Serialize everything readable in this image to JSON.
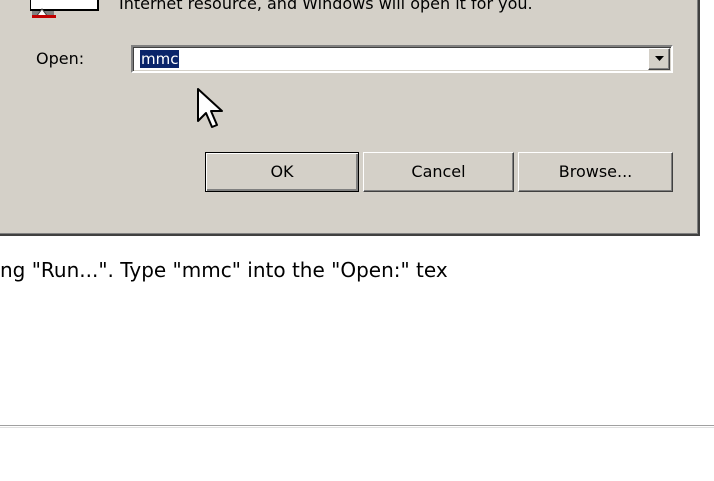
{
  "dialog": {
    "description": "Internet resource, and Windows will open it for you.",
    "open_label": "Open:",
    "open_value": "mmc",
    "buttons": {
      "ok": "OK",
      "cancel": "Cancel",
      "browse": "Browse..."
    },
    "icons": {
      "app": "run-program-icon",
      "dropdown": "chevron-down-icon",
      "cursor": "mouse-pointer-icon"
    },
    "colors": {
      "dialog_bg": "#d4d0c8",
      "selection_bg": "#0a246a"
    }
  },
  "instruction": {
    "text": "ng \"Run...\". Type \"mmc\" into the \"Open:\" tex"
  }
}
